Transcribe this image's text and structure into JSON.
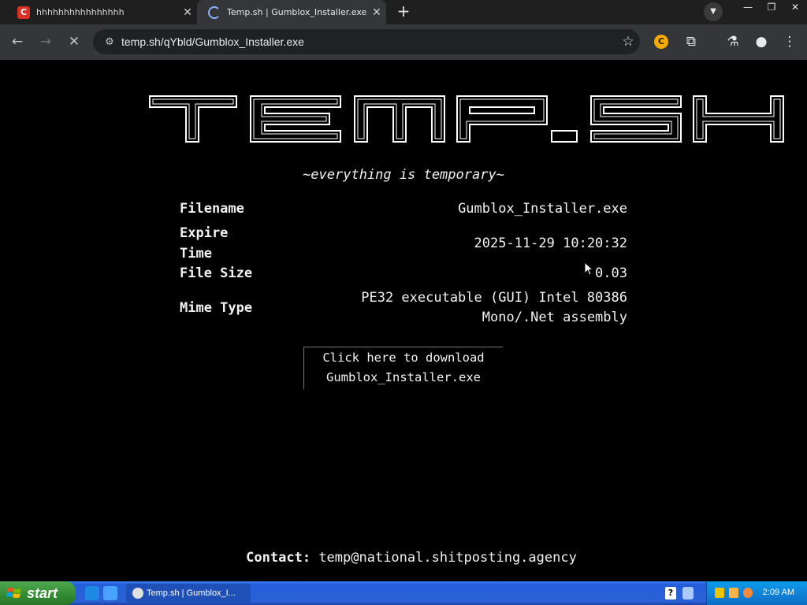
{
  "browser": {
    "tabs": [
      {
        "title": "hhhhhhhhhhhhhhhh",
        "active": false
      },
      {
        "title": "Temp.sh | Gumblox_Installer.exe",
        "active": true
      }
    ],
    "url": "temp.sh/qYbld/Gumblox_Installer.exe",
    "extension_badge": "C"
  },
  "page": {
    "logo_text": "TEMP.SH",
    "tagline": "~everything is temporary~",
    "fields": {
      "filename_label": "Filename",
      "filename_value": "Gumblox_Installer.exe",
      "expire_label_1": "Expire",
      "expire_label_2": "Time",
      "expire_value": "2025-11-29 10:20:32",
      "size_label": "File Size",
      "size_value": "0.03",
      "mime_label": "Mime Type",
      "mime_value_1": "PE32 executable (GUI) Intel 80386",
      "mime_value_2": "Mono/.Net assembly"
    },
    "download": {
      "line1": "Click here to download",
      "line2": "Gumblox_Installer.exe"
    },
    "contact_label": "Contact:",
    "contact_email": "temp@national.shitposting.agency"
  },
  "taskbar": {
    "start_label": "start",
    "task_title": "Temp.sh | Gumblox_I...",
    "clock": "2:09 AM",
    "help_icon_text": "?"
  },
  "colors": {
    "page_bg": "#000000",
    "page_text": "#f2f2f2",
    "chrome_bg": "#35363a",
    "xp_taskbar": "#245edb",
    "xp_start": "#318b31"
  }
}
